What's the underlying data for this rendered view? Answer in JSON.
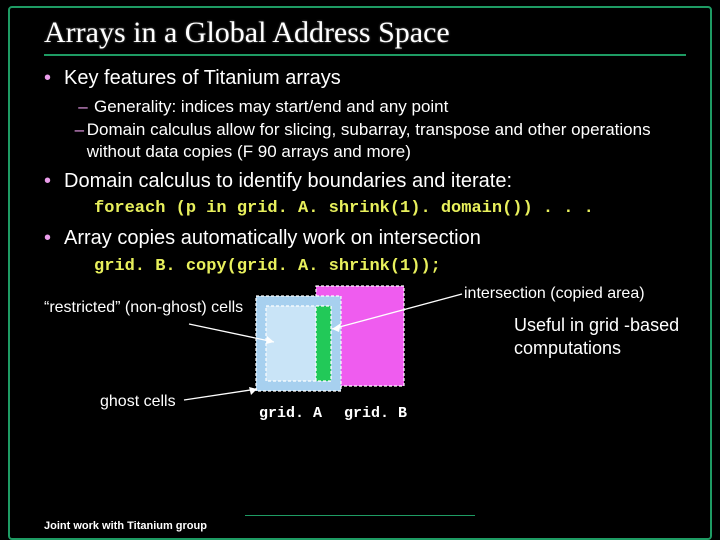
{
  "title": "Arrays in a Global Address Space",
  "bullets": {
    "b1a": "Key features of Titanium arrays",
    "b2a": "Generality: indices may start/end and any point",
    "b2b": "Domain calculus allow for slicing, subarray, transpose and other operations without data copies (F 90 arrays and more)",
    "b1b": "Domain calculus to identify boundaries and iterate:",
    "code1": "foreach (p in grid. A. shrink(1). domain()) . . .",
    "b1c": "Array copies automatically work on intersection",
    "code2": "grid. B. copy(grid. A. shrink(1));"
  },
  "diagram": {
    "restricted": "“restricted” (non-ghost) cells",
    "ghost": "ghost cells",
    "intersection": "intersection (copied area)",
    "useful": "Useful in   grid -based computations",
    "gridA": "grid. A",
    "gridB": "grid. B"
  },
  "footer": "Joint work with Titanium group"
}
